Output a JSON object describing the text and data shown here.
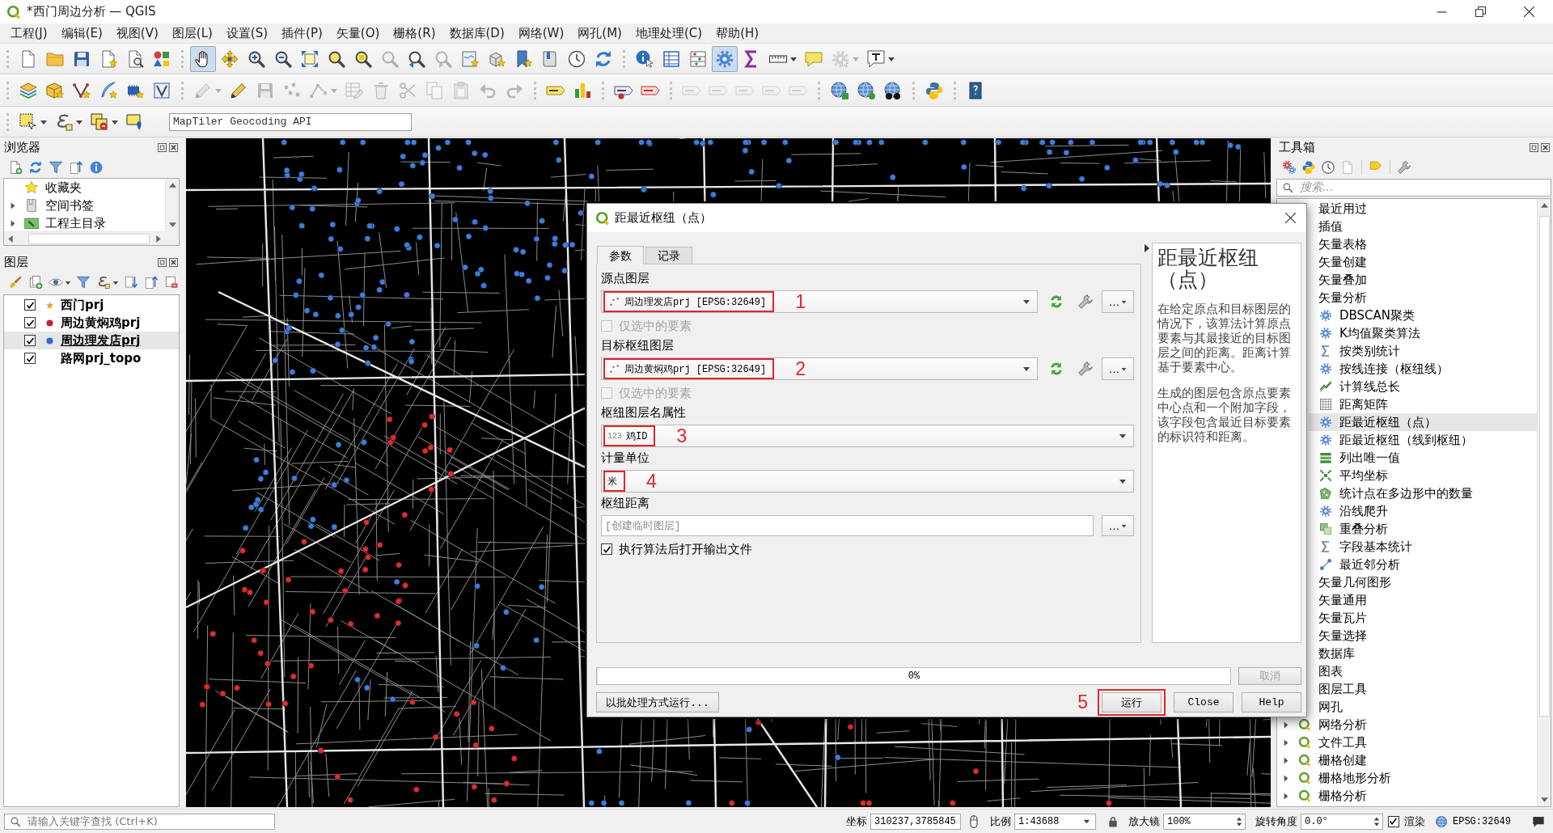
{
  "window": {
    "title": "*西门周边分析 — QGIS"
  },
  "menu": [
    "工程(J)",
    "编辑(E)",
    "视图(V)",
    "图层(L)",
    "设置(S)",
    "插件(P)",
    "矢量(O)",
    "栅格(R)",
    "数据库(D)",
    "网络(W)",
    "网孔(M)",
    "地理处理(C)",
    "帮助(H)"
  ],
  "toolbars": [
    [
      [
        {
          "kind": "new_project",
          "pressed": false,
          "disabled": false
        },
        {
          "kind": "open_project",
          "pressed": false,
          "disabled": false
        },
        {
          "kind": "save_project",
          "pressed": false,
          "disabled": false
        },
        {
          "kind": "new_layout",
          "pressed": false,
          "disabled": false
        },
        {
          "kind": "layout_manager",
          "pressed": false,
          "disabled": false
        },
        {
          "kind": "style_manager",
          "pressed": false,
          "disabled": false
        }
      ],
      [
        {
          "kind": "pan",
          "pressed": true,
          "disabled": false
        },
        {
          "kind": "pan_to_selection",
          "pressed": false,
          "disabled": false
        },
        {
          "kind": "zoom_in",
          "pressed": false,
          "disabled": false
        },
        {
          "kind": "zoom_out",
          "pressed": false,
          "disabled": false
        },
        {
          "kind": "zoom_full",
          "pressed": false,
          "disabled": false
        },
        {
          "kind": "zoom_layer",
          "pressed": false,
          "disabled": false
        },
        {
          "kind": "zoom_selection",
          "pressed": false,
          "disabled": false
        },
        {
          "kind": "zoom_native",
          "pressed": false,
          "disabled": true
        },
        {
          "kind": "zoom_last",
          "pressed": false,
          "disabled": false
        },
        {
          "kind": "zoom_next",
          "pressed": false,
          "disabled": true
        },
        {
          "kind": "new_map_view",
          "pressed": false,
          "disabled": false
        },
        {
          "kind": "new_3d_view",
          "pressed": false,
          "disabled": false
        },
        {
          "kind": "new_bookmark",
          "pressed": false,
          "disabled": false
        },
        {
          "kind": "show_bookmarks",
          "pressed": false,
          "disabled": false
        },
        {
          "kind": "temporal",
          "pressed": false,
          "disabled": false
        },
        {
          "kind": "refresh",
          "pressed": false,
          "disabled": false
        }
      ],
      [
        {
          "kind": "identify",
          "pressed": false,
          "disabled": false
        },
        {
          "kind": "attribute_table",
          "pressed": false,
          "disabled": false
        },
        {
          "kind": "field_calculator",
          "pressed": false,
          "disabled": false
        },
        {
          "kind": "toolbox",
          "pressed": true,
          "disabled": false
        },
        {
          "kind": "statistics",
          "pressed": false,
          "disabled": false
        },
        {
          "kind": "measure",
          "pressed": false,
          "disabled": false
        },
        {
          "kind": "map_tips",
          "pressed": false,
          "disabled": false
        },
        {
          "kind": "annotation_tool",
          "pressed": false,
          "disabled": true
        },
        {
          "kind": "text_annotation",
          "pressed": false,
          "disabled": false
        }
      ]
    ],
    [
      [
        {
          "kind": "data_source_manager",
          "pressed": false,
          "disabled": false
        },
        {
          "kind": "new_geopackage",
          "pressed": false,
          "disabled": false
        },
        {
          "kind": "new_shapefile",
          "pressed": false,
          "disabled": false
        },
        {
          "kind": "new_spatialite",
          "pressed": false,
          "disabled": false
        },
        {
          "kind": "new_temporary",
          "pressed": false,
          "disabled": false
        },
        {
          "kind": "new_virtual",
          "pressed": false,
          "disabled": false
        }
      ],
      [
        {
          "kind": "current_edits",
          "pressed": false,
          "disabled": true
        },
        {
          "kind": "toggle_editing",
          "pressed": false,
          "disabled": false
        },
        {
          "kind": "save_edits",
          "pressed": false,
          "disabled": true
        },
        {
          "kind": "add_feature",
          "pressed": false,
          "disabled": true
        },
        {
          "kind": "vertex_tool",
          "pressed": false,
          "disabled": true
        },
        {
          "kind": "modify_attributes",
          "pressed": false,
          "disabled": true
        },
        {
          "kind": "delete_selected",
          "pressed": false,
          "disabled": true
        },
        {
          "kind": "cut",
          "pressed": false,
          "disabled": true
        },
        {
          "kind": "copy",
          "pressed": false,
          "disabled": true
        },
        {
          "kind": "paste",
          "pressed": false,
          "disabled": true
        },
        {
          "kind": "undo",
          "pressed": false,
          "disabled": true
        },
        {
          "kind": "redo",
          "pressed": false,
          "disabled": true
        }
      ],
      [
        {
          "kind": "labeling",
          "pressed": false,
          "disabled": false
        },
        {
          "kind": "diagram",
          "pressed": false,
          "disabled": false
        }
      ],
      [
        {
          "kind": "pin_labels",
          "pressed": false,
          "disabled": false
        },
        {
          "kind": "highlight_labels",
          "pressed": false,
          "disabled": false
        }
      ],
      [
        {
          "kind": "label_tool",
          "pressed": false,
          "disabled": true
        },
        {
          "kind": "label_tool",
          "pressed": false,
          "disabled": true
        },
        {
          "kind": "label_tool",
          "pressed": false,
          "disabled": true
        },
        {
          "kind": "label_tool",
          "pressed": false,
          "disabled": true
        },
        {
          "kind": "label_tool",
          "pressed": false,
          "disabled": true
        }
      ],
      [
        {
          "kind": "add_wms",
          "pressed": false,
          "disabled": false
        },
        {
          "kind": "add_wfs",
          "pressed": false,
          "disabled": false
        },
        {
          "kind": "search_services",
          "pressed": false,
          "disabled": false
        }
      ],
      [
        {
          "kind": "python",
          "pressed": false,
          "disabled": false
        }
      ],
      [
        {
          "kind": "help",
          "pressed": false,
          "disabled": false
        }
      ]
    ],
    [
      [
        {
          "kind": "select",
          "pressed": false,
          "disabled": false
        },
        {
          "kind": "select_expression",
          "pressed": false,
          "disabled": false
        },
        {
          "kind": "deselect",
          "pressed": false,
          "disabled": false
        },
        {
          "kind": "select_location",
          "pressed": false,
          "disabled": false
        }
      ]
    ]
  ],
  "geocoder": {
    "value": "MapTiler Geocoding API"
  },
  "browser_panel": {
    "title": "浏览器",
    "items": [
      {
        "label": "收藏夹",
        "kind": "favorites"
      },
      {
        "label": "空间书签",
        "kind": "bookmarks",
        "expanded": false
      },
      {
        "label": "工程主目录",
        "kind": "home",
        "expanded": false
      }
    ]
  },
  "layers_panel": {
    "title": "图层",
    "layers": [
      {
        "name": "西门prj",
        "checked": true,
        "selected": false,
        "kind": "star",
        "color": "#f0a020"
      },
      {
        "name": "周边黄焖鸡prj",
        "checked": true,
        "selected": false,
        "kind": "point",
        "color": "#c0282d"
      },
      {
        "name": "周边理发店prj",
        "checked": true,
        "selected": true,
        "kind": "point",
        "color": "#2e6fc0"
      },
      {
        "name": "路网prj_topo",
        "checked": true,
        "selected": false,
        "kind": "line"
      }
    ]
  },
  "toolbox": {
    "title": "工具箱",
    "search": {
      "placeholder": "搜索..."
    },
    "items": [
      {
        "label": "最近用过",
        "selected": false
      },
      {
        "label": "插值",
        "selected": false
      },
      {
        "label": "矢量表格",
        "selected": false
      },
      {
        "label": "矢量创建",
        "selected": false
      },
      {
        "label": "矢量叠加",
        "selected": false
      },
      {
        "label": "矢量分析",
        "expanded": true,
        "selected": false,
        "children": [
          {
            "label": "DBSCAN聚类",
            "kind": "algorithm",
            "selected": false
          },
          {
            "label": "K均值聚类算法",
            "kind": "algorithm",
            "selected": false
          },
          {
            "label": "按类别统计",
            "kind": "sum",
            "selected": false
          },
          {
            "label": "按线连接（枢纽线）",
            "kind": "algorithm",
            "selected": false
          },
          {
            "label": "计算线总长",
            "kind": "length",
            "selected": false
          },
          {
            "label": "距离矩阵",
            "kind": "matrix",
            "selected": false
          },
          {
            "label": "距最近枢纽（点）",
            "kind": "algorithm",
            "selected": true
          },
          {
            "label": "距最近枢纽（线到枢纽）",
            "kind": "algorithm",
            "selected": false
          },
          {
            "label": "列出唯一值",
            "kind": "unique",
            "selected": false
          },
          {
            "label": "平均坐标",
            "kind": "mean",
            "selected": false
          },
          {
            "label": "统计点在多边形中的数量",
            "kind": "count",
            "selected": false
          },
          {
            "label": "沿线爬升",
            "kind": "algorithm",
            "selected": false
          },
          {
            "label": "重叠分析",
            "kind": "overlap",
            "selected": false
          },
          {
            "label": "字段基本统计",
            "kind": "sum",
            "selected": false
          },
          {
            "label": "最近邻分析",
            "kind": "nearest",
            "selected": false
          }
        ]
      },
      {
        "label": "矢量几何图形",
        "selected": false
      },
      {
        "label": "矢量通用",
        "selected": false
      },
      {
        "label": "矢量瓦片",
        "selected": false
      },
      {
        "label": "矢量选择",
        "selected": false
      },
      {
        "label": "数据库",
        "selected": false
      },
      {
        "label": "图表",
        "selected": false
      },
      {
        "label": "图层工具",
        "selected": false
      },
      {
        "label": "网孔",
        "selected": false
      },
      {
        "label": "网络分析",
        "expanded": false,
        "selected": false
      },
      {
        "label": "文件工具",
        "expanded": false,
        "selected": false
      },
      {
        "label": "栅格创建",
        "expanded": false,
        "selected": false
      },
      {
        "label": "栅格地形分析",
        "expanded": false,
        "selected": false
      },
      {
        "label": "栅格分析",
        "expanded": false,
        "selected": false
      }
    ]
  },
  "dialog": {
    "title": "距最近枢纽（点）",
    "tabs": [
      {
        "label": "参数",
        "selected": true
      },
      {
        "label": "记录",
        "selected": false
      }
    ],
    "parameters": [
      {
        "kind": "layer",
        "label": "源点图层",
        "value": "周边理发店prj [EPSG:32649]",
        "annotation": "1",
        "button": "…"
      },
      {
        "kind": "checkbox",
        "label": "仅选中的要素",
        "checked": false,
        "disabled": true
      },
      {
        "kind": "layer",
        "label": "目标枢纽图层",
        "value": "周边黄焖鸡prj [EPSG:32649]",
        "annotation": "2",
        "button": "…"
      },
      {
        "kind": "checkbox",
        "label": "仅选中的要素",
        "checked": false,
        "disabled": true
      },
      {
        "kind": "field",
        "label": "枢纽图层名属性",
        "type_label": "123",
        "value": "鸡ID",
        "annotation": "3"
      },
      {
        "kind": "enum",
        "label": "计量单位",
        "value": "米",
        "annotation": "4"
      },
      {
        "kind": "output",
        "label": "枢纽距离",
        "placeholder": "[创建临时图层]",
        "button": "…"
      },
      {
        "kind": "checkbox",
        "label": "执行算法后打开输出文件",
        "checked": true,
        "disabled": false
      }
    ],
    "help": {
      "title": "距最近枢纽（点）",
      "paragraphs": [
        "在给定原点和目标图层的情况下，该算法计算原点要素与其最接近的目标图层之间的距离。距离计算基于要素中心。",
        "生成的图层包含原点要素中心点和一个附加字段，该字段包含最近目标要素的标识符和距离。"
      ]
    },
    "progress": {
      "level": 0,
      "text": "0%"
    },
    "cancel_button": {
      "label": "取消",
      "disabled": true
    },
    "batch_button": {
      "label": "以批处理方式运行..."
    },
    "buttons": [
      {
        "label": "运行",
        "annotation": "5",
        "disabled": false
      },
      {
        "label": "Close",
        "disabled": false
      },
      {
        "label": "Help",
        "disabled": false
      }
    ]
  },
  "status_bar": {
    "locator": {
      "placeholder": "请输入关键字查找 (Ctrl+K)"
    },
    "coordinate": {
      "label": "坐标",
      "value": "310237,3785845"
    },
    "scale": {
      "label": "比例",
      "value": "1:43688"
    },
    "magnifier": {
      "label": "放大镜",
      "value": "100%"
    },
    "rotation": {
      "label": "旋转角度",
      "value": "0.0°"
    },
    "render": {
      "label": "渲染",
      "checked": true
    },
    "crs": "EPSG:32649"
  }
}
